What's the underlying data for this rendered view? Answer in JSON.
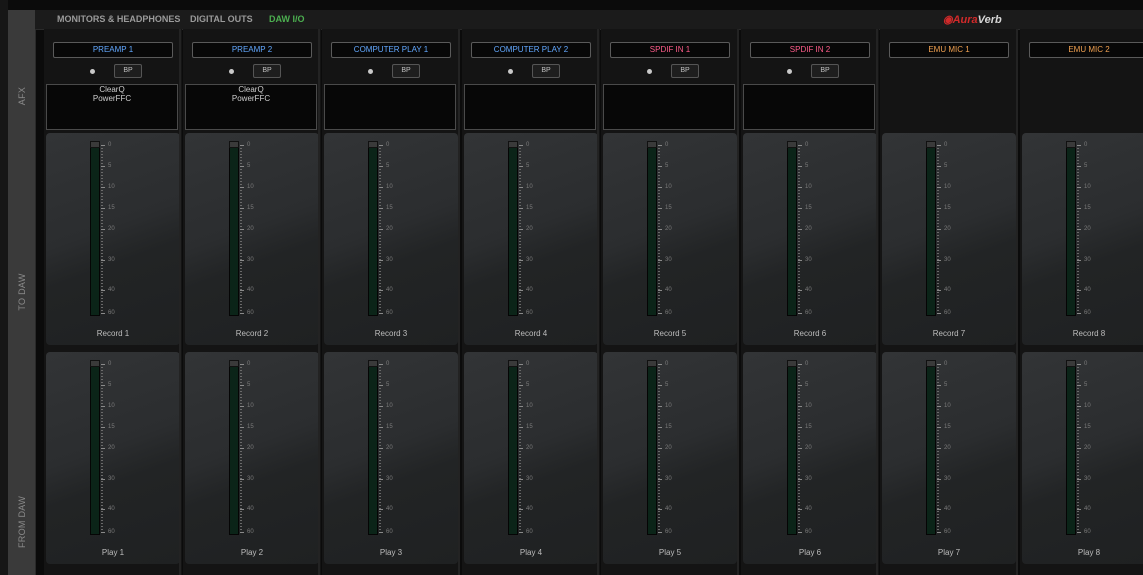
{
  "nav": {
    "tabs": [
      {
        "label": "MONITORS & HEADPHONES",
        "active": false
      },
      {
        "label": "DIGITAL OUTS",
        "active": false
      },
      {
        "label": "DAW I/O",
        "active": true
      }
    ],
    "logo": {
      "aura": "Aura",
      "verb": "Verb"
    }
  },
  "sidebar": {
    "afx": "AFX",
    "to_daw": "TO DAW",
    "from_daw": "FROM DAW"
  },
  "meter_scale": [
    "0",
    "5",
    "10",
    "15",
    "20",
    "30",
    "40",
    "60"
  ],
  "colors": {
    "active_tab": "#4caf50",
    "name_blue": "#62a8ff",
    "name_pink": "#ff5d8a",
    "name_orange": "#f0a050",
    "logo_red": "#d02a2a"
  },
  "channels": [
    {
      "name": "PREAMP 1",
      "color": "blue",
      "afx": true,
      "bp_label": "BP",
      "fx": [
        "ClearQ",
        "PowerFFC"
      ],
      "record_label": "Record 1",
      "play_label": "Play 1"
    },
    {
      "name": "PREAMP 2",
      "color": "blue",
      "afx": true,
      "bp_label": "BP",
      "fx": [
        "ClearQ",
        "PowerFFC"
      ],
      "record_label": "Record 2",
      "play_label": "Play 2"
    },
    {
      "name": "COMPUTER PLAY 1",
      "color": "blue",
      "afx": true,
      "bp_label": "BP",
      "fx": [],
      "record_label": "Record 3",
      "play_label": "Play 3"
    },
    {
      "name": "COMPUTER PLAY 2",
      "color": "blue",
      "afx": true,
      "bp_label": "BP",
      "fx": [],
      "record_label": "Record 4",
      "play_label": "Play 4"
    },
    {
      "name": "SPDIF IN 1",
      "color": "pink",
      "afx": true,
      "bp_label": "BP",
      "fx": [],
      "record_label": "Record 5",
      "play_label": "Play 5"
    },
    {
      "name": "SPDIF IN 2",
      "color": "pink",
      "afx": true,
      "bp_label": "BP",
      "fx": [],
      "record_label": "Record 6",
      "play_label": "Play 6"
    },
    {
      "name": "EMU MIC 1",
      "color": "orange",
      "afx": false,
      "fx": [],
      "record_label": "Record 7",
      "play_label": "Play 7"
    },
    {
      "name": "EMU MIC 2",
      "color": "orange",
      "afx": false,
      "fx": [],
      "record_label": "Record 8",
      "play_label": "Play 8"
    }
  ]
}
